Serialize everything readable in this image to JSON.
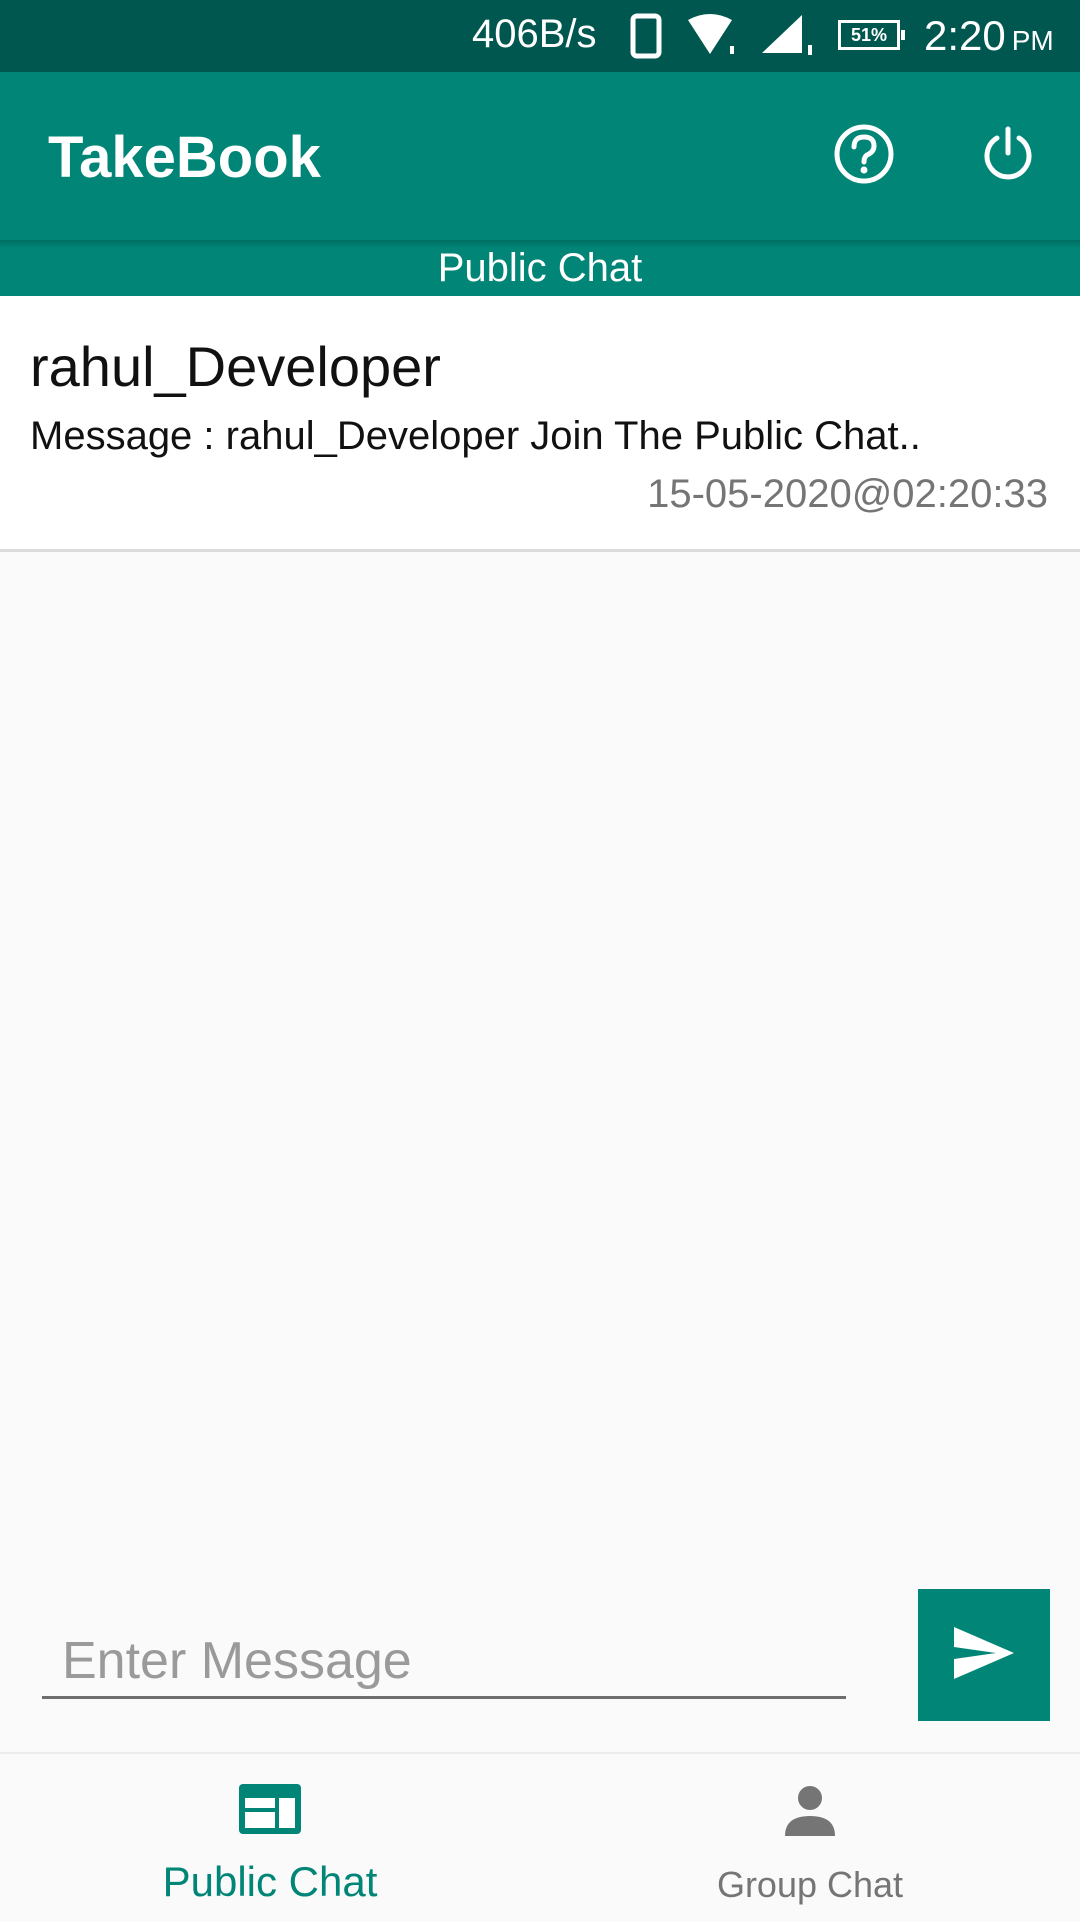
{
  "status_bar": {
    "net_speed": "406B/s",
    "battery": "51%",
    "time": "2:20",
    "ampm": "PM"
  },
  "app_bar": {
    "title": "TakeBook",
    "help_icon": "help-circle-icon",
    "power_icon": "power-icon"
  },
  "section": {
    "title": "Public Chat"
  },
  "messages": [
    {
      "sender": "rahul_Developer",
      "text": "Message : rahul_Developer Join The Public Chat..",
      "timestamp": "15-05-2020@02:20:33"
    }
  ],
  "composer": {
    "placeholder": "Enter Message",
    "send_icon": "send-icon"
  },
  "bottom_nav": [
    {
      "label": "Public Chat",
      "icon": "web-icon",
      "active": true
    },
    {
      "label": "Group Chat",
      "icon": "person-icon",
      "active": false
    }
  ],
  "colors": {
    "primary": "#008577",
    "primary_dark": "#00574f",
    "inactive": "#757575"
  }
}
